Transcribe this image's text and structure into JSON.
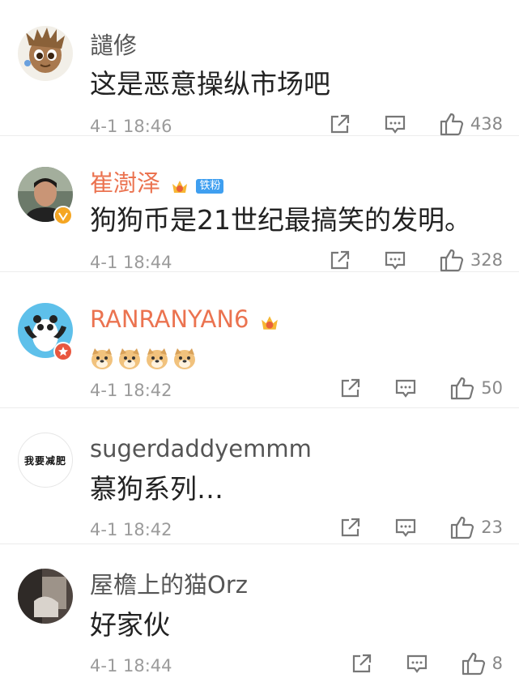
{
  "colors": {
    "orange_name": "#eb7350",
    "gray_name": "#555555",
    "meta": "#9b9b9b",
    "divider": "#ececec"
  },
  "comments": [
    {
      "username": "譴修",
      "text": "这是恶意操纵市场吧",
      "time": "4-1 18:46",
      "likes": "438",
      "avatar": "groot-avatar"
    },
    {
      "username": "崔澍泽",
      "badge_text": "铁粉",
      "text": "狗狗币是21世纪最搞笑的发明。",
      "time": "4-1 18:44",
      "likes": "328",
      "avatar": "man-photo-avatar",
      "verified": true,
      "vip_level": "5"
    },
    {
      "username": "RANRANYAN6",
      "emoji": [
        "doge-emoji",
        "doge-emoji",
        "doge-emoji",
        "doge-emoji"
      ],
      "time": "4-1 18:42",
      "likes": "50",
      "avatar": "panda-avatar",
      "star_badge": true
    },
    {
      "username": "sugerdaddyemmm",
      "avatar_text": "我要减肥",
      "text": "慕狗系列…",
      "time": "4-1 18:42",
      "likes": "23",
      "avatar": "text-avatar"
    },
    {
      "username": "屋檐上的猫Orz",
      "text": "好家伙",
      "time": "4-1 18:44",
      "likes": "8",
      "avatar": "cat-photo-avatar"
    }
  ]
}
